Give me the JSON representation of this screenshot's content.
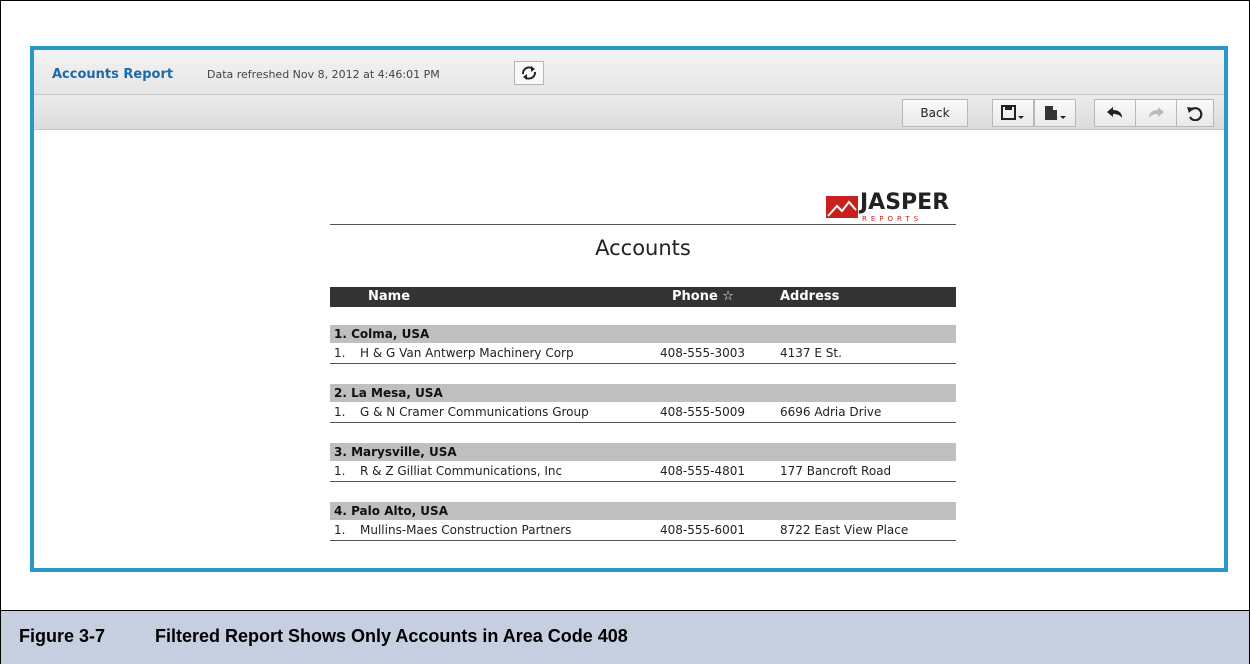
{
  "header": {
    "report_title": "Accounts Report",
    "refresh_text": "Data refreshed Nov 8, 2012 at 4:46:01 PM",
    "refresh_icon": "refresh-icon"
  },
  "toolbar": {
    "back_label": "Back",
    "save_icon": "save-icon",
    "export_icon": "export-icon",
    "undo_icon": "undo-icon",
    "redo_icon": "redo-icon",
    "undo_all_icon": "undo-all-icon"
  },
  "logo": {
    "main": "JASPER",
    "sub": "REPORTS"
  },
  "report": {
    "title": "Accounts",
    "columns": {
      "name": "Name",
      "phone": "Phone ☆",
      "address": "Address"
    },
    "groups": [
      {
        "label": "1. Colma, USA",
        "rows": [
          {
            "index": "1.",
            "name": "H & G Van Antwerp Machinery Corp",
            "phone": "408-555-3003",
            "address": "4137 E St."
          }
        ]
      },
      {
        "label": "2. La Mesa, USA",
        "rows": [
          {
            "index": "1.",
            "name": "G & N Cramer Communications Group",
            "phone": "408-555-5009",
            "address": "6696 Adria Drive"
          }
        ]
      },
      {
        "label": "3. Marysville, USA",
        "rows": [
          {
            "index": "1.",
            "name": "R & Z Gilliat Communications, Inc",
            "phone": "408-555-4801",
            "address": "177 Bancroft Road"
          }
        ]
      },
      {
        "label": "4. Palo Alto, USA",
        "rows": [
          {
            "index": "1.",
            "name": "Mullins-Maes Construction Partners",
            "phone": "408-555-6001",
            "address": "8722 East View Place"
          }
        ]
      }
    ]
  },
  "caption": {
    "figure": "Figure 3-7",
    "text": "Filtered Report Shows Only Accounts in Area Code 408"
  }
}
